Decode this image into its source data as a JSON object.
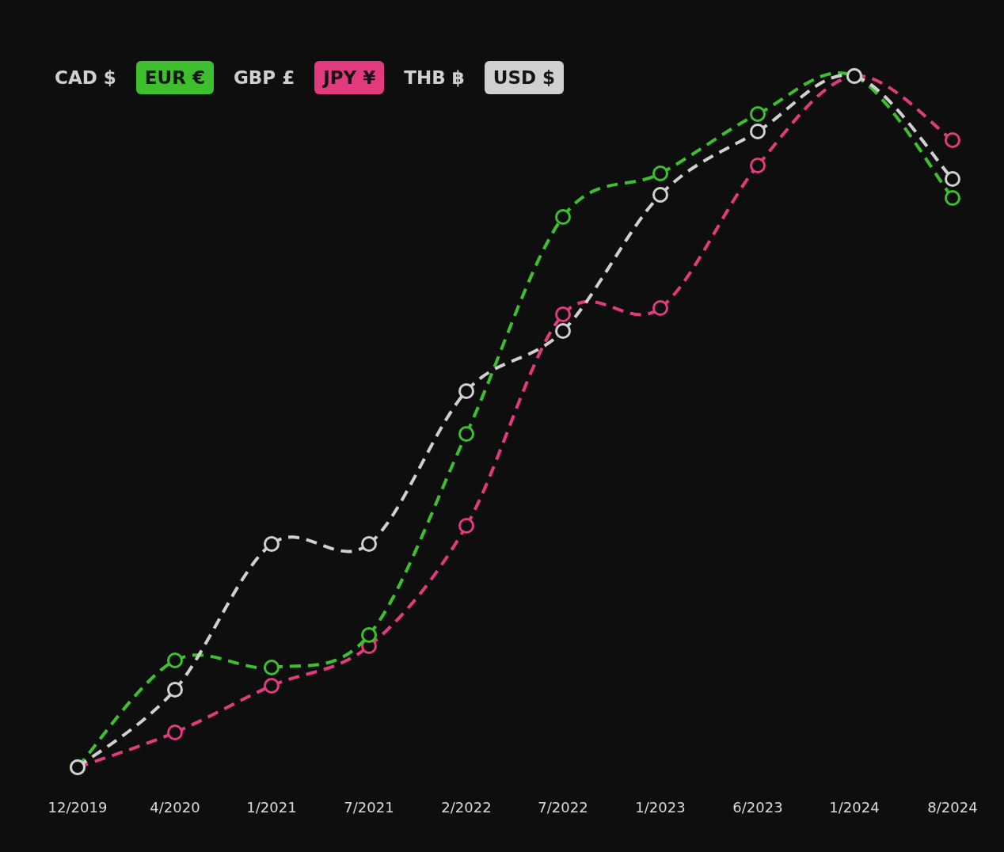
{
  "legend": [
    {
      "label": "CAD $",
      "selected": false
    },
    {
      "label": "EUR €",
      "selected": true,
      "color": "#3ec02e"
    },
    {
      "label": "GBP £",
      "selected": false
    },
    {
      "label": "JPY ¥",
      "selected": true,
      "color": "#e23a7e"
    },
    {
      "label": "THB ฿",
      "selected": false
    },
    {
      "label": "USD $",
      "selected": true,
      "color": "#d0d0d0"
    }
  ],
  "x_labels": [
    "12/2019",
    "4/2020",
    "1/2021",
    "7/2021",
    "2/2022",
    "7/2022",
    "1/2023",
    "6/2023",
    "1/2024",
    "8/2024"
  ]
}
